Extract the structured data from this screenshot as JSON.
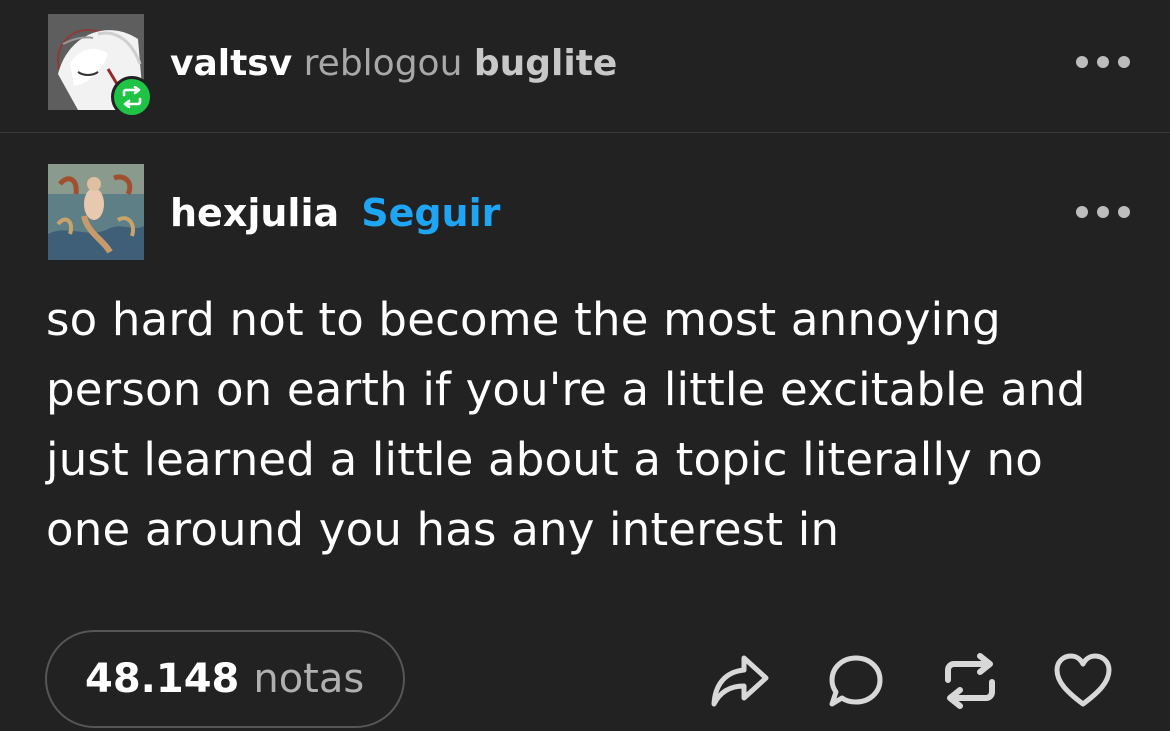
{
  "reblog": {
    "reblogger": "valtsv",
    "verb": "reblogou",
    "source": "buglite"
  },
  "post": {
    "author": "hexjulia",
    "follow_label": "Seguir",
    "text": "so hard not to become the most annoying person on earth if you're a little excitable and just learned a little about a topic literally no one around you has any interest in"
  },
  "footer": {
    "notes_count": "48.148",
    "notes_label": "notas"
  },
  "icons": {
    "reblog_badge": "reblog-icon",
    "more": "more-horizontal-icon",
    "share": "share-icon",
    "reply": "reply-icon",
    "reblog": "reblog-icon",
    "like": "heart-icon"
  },
  "colors": {
    "background": "#222222",
    "follow": "#1ea6f5",
    "reblog_badge": "#1fc445"
  }
}
